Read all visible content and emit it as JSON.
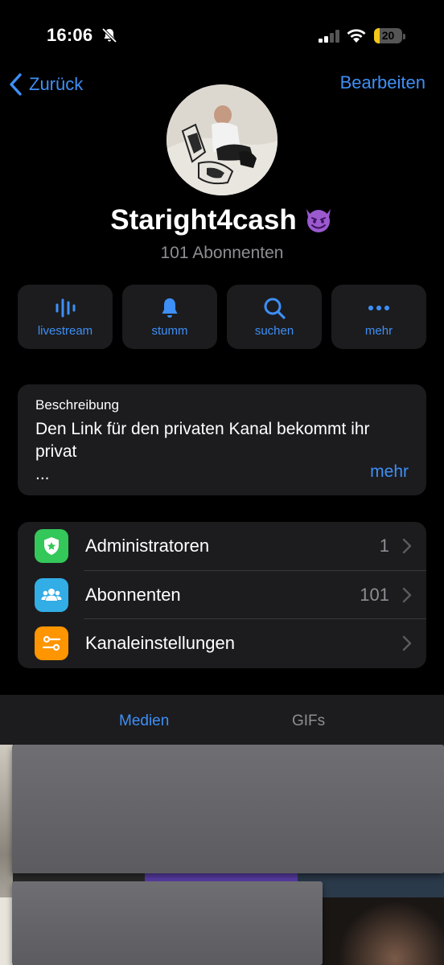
{
  "status_bar": {
    "time": "16:06",
    "battery_level": "20",
    "battery_fraction": 0.2,
    "icons": [
      "bell-slash-icon",
      "cellular-signal-icon",
      "wifi-icon",
      "battery-icon"
    ]
  },
  "nav": {
    "back_label": "Zurück",
    "edit_label": "Bearbeiten"
  },
  "channel": {
    "name": "Staright4cash",
    "emoji": "smiling-face-with-horns-icon",
    "subscribers": "101 Abonnenten"
  },
  "actions": [
    {
      "label": "livestream",
      "icon": "livestream-waveform-icon"
    },
    {
      "label": "stumm",
      "icon": "bell-icon"
    },
    {
      "label": "suchen",
      "icon": "search-icon"
    },
    {
      "label": "mehr",
      "icon": "more-dots-icon"
    }
  ],
  "description": {
    "label": "Beschreibung",
    "text": "Den Link für den privaten Kanal bekommt ihr privat",
    "ellipsis": "...",
    "more_label": "mehr"
  },
  "settings": [
    {
      "label": "Administratoren",
      "value": "1",
      "icon": "shield-star-icon",
      "color": "#34c759"
    },
    {
      "label": "Abonnenten",
      "value": "101",
      "icon": "people-icon",
      "color": "#32ade6"
    },
    {
      "label": "Kanaleinstellungen",
      "value": "",
      "icon": "sliders-icon",
      "color": "#ff9500"
    }
  ],
  "tabs": [
    {
      "label": "Medien",
      "active": true
    },
    {
      "label": "GIFs",
      "active": false
    }
  ],
  "colors": {
    "accent": "#3e8ff6",
    "background": "#000000",
    "card": "#1c1c1e",
    "secondary_text": "#8d8d93"
  }
}
